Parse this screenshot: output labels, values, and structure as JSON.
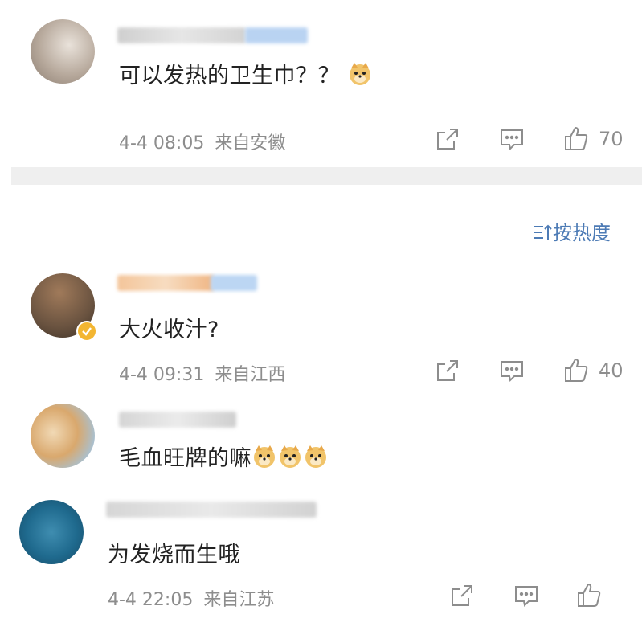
{
  "comments_top": [
    {
      "text": "可以发热的卫生巾？？",
      "time": "4-4 08:05",
      "location": "来自安徽",
      "likes": "70",
      "emoji": [
        "doge"
      ]
    }
  ],
  "sort": {
    "label": "按热度",
    "icon": "sort-icon"
  },
  "comments_main": [
    {
      "text": "大火收汁?",
      "time": "4-4 09:31",
      "location": "来自江西",
      "likes": "40",
      "verified": true
    },
    {
      "text": "毛血旺牌的嘛",
      "emoji": [
        "doge",
        "doge",
        "doge"
      ]
    },
    {
      "text": "为发烧而生哦",
      "time": "4-4 22:05",
      "location": "来自江苏",
      "likes": ""
    }
  ],
  "icons": {
    "share": "share-icon",
    "comment": "comment-icon",
    "like": "thumbs-up-icon",
    "emoji": "doge-emoji"
  },
  "colors": {
    "link": "#4d7bb5",
    "meta": "#8d8d8d",
    "divider": "#efefef",
    "badge": "#f3b632"
  }
}
